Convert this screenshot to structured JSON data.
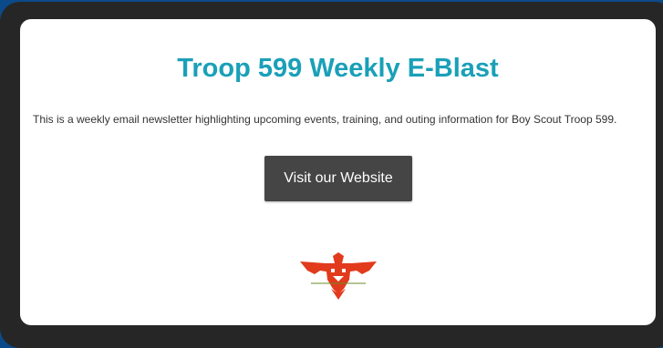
{
  "email": {
    "title": "Troop 599 Weekly E-Blast",
    "description": "This is a weekly email newsletter highlighting upcoming events, training, and outing information for Boy Scout Troop 599.",
    "button_label": "Visit our Website",
    "logo_icon": "thunderbird-logo-icon"
  },
  "colors": {
    "title": "#1aa0b8",
    "button_bg": "#454545",
    "logo": "#e23a1c",
    "background": "#0b4a8a",
    "frame": "#262626"
  }
}
